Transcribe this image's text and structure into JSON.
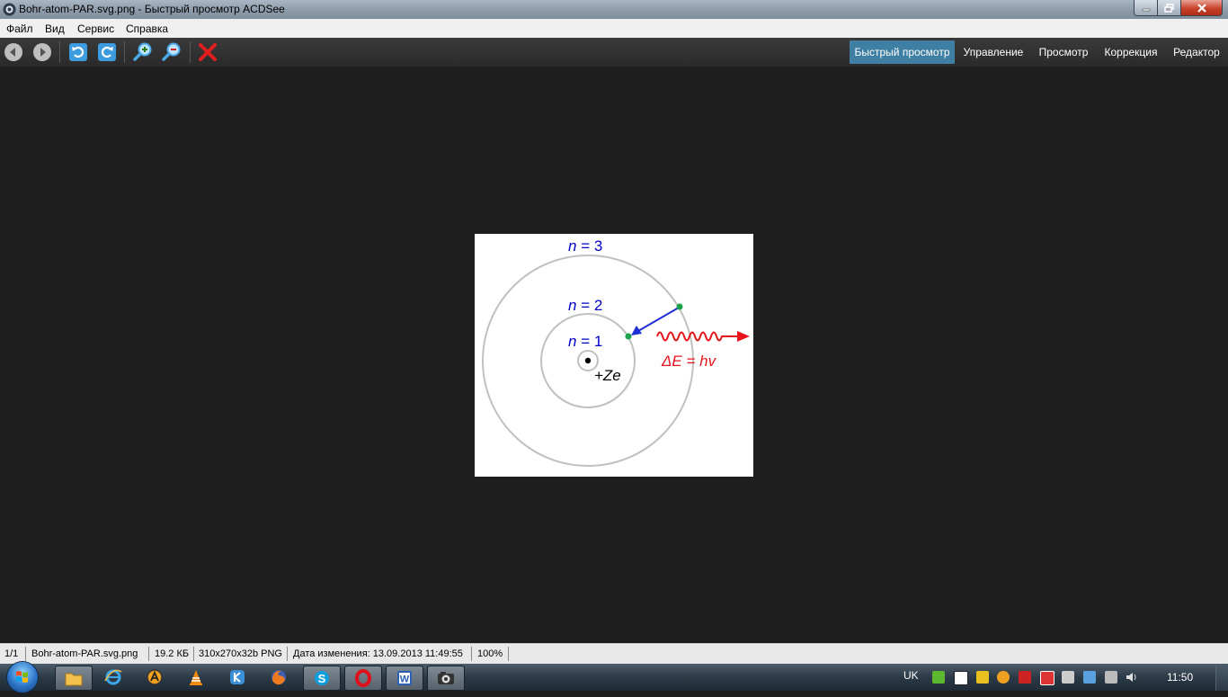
{
  "window": {
    "title": "Bohr-atom-PAR.svg.png - Быстрый просмотр ACDSee"
  },
  "menu": {
    "items": [
      "Файл",
      "Вид",
      "Сервис",
      "Справка"
    ]
  },
  "toolbar": {
    "icons": [
      "back-icon",
      "forward-icon",
      "rotate-left-icon",
      "rotate-right-icon",
      "zoom-in-icon",
      "zoom-out-icon",
      "delete-icon"
    ],
    "modes": [
      "Быстрый просмотр",
      "Управление",
      "Просмотр",
      "Коррекция",
      "Редактор"
    ],
    "active_mode": "Быстрый просмотр"
  },
  "image": {
    "label_n3_var": "n",
    "label_n3_rest": " = 3",
    "label_n2_var": "n",
    "label_n2_rest": " = 2",
    "label_n1_var": "n",
    "label_n1_rest": " = 1",
    "nucleus_charge": "+Ze",
    "energy_label": "ΔE = hv",
    "colors": {
      "orbit": "#c0c0c0",
      "label": "#0000c8",
      "electron": "#1aa34a",
      "transition_arrow": "#1f2fd6",
      "photon": "#e8141c"
    }
  },
  "statusbar": {
    "index": "1/1",
    "filename": "Bohr-atom-PAR.svg.png",
    "filesize": "19.2 КБ",
    "dimensions": "310x270x32b PNG",
    "modified": "Дата изменения: 13.09.2013 11:49:55",
    "zoom": "100%"
  },
  "taskbar": {
    "apps": [
      "windows-explorer",
      "internet-explorer",
      "app-orange-a",
      "vlc",
      "app-blue-k",
      "firefox",
      "skype",
      "opera",
      "word",
      "acdsee"
    ],
    "language": "UK",
    "clock": "11:50"
  }
}
